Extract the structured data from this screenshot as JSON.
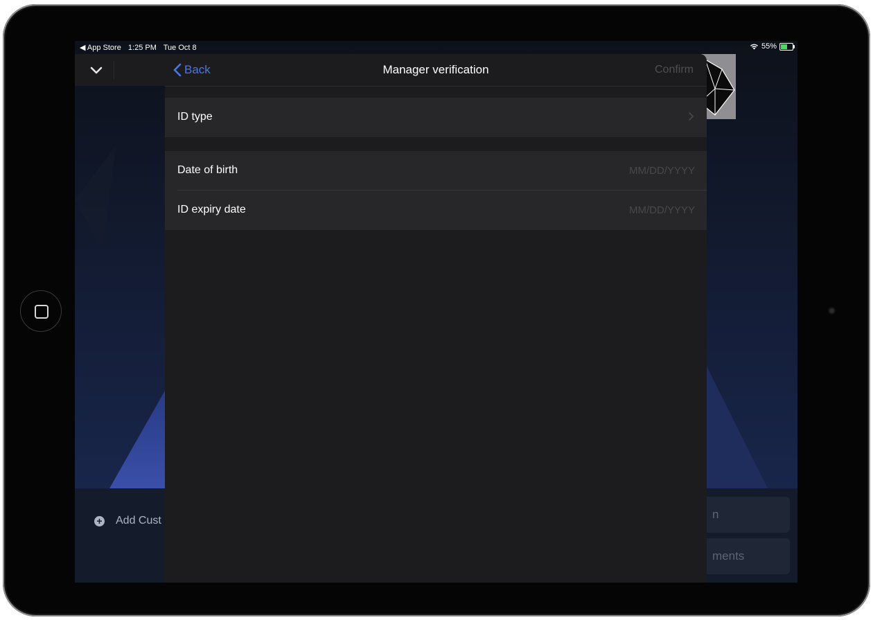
{
  "status_bar": {
    "back_app": "◀ App Store",
    "time": "1:25 PM",
    "date": "Tue Oct 8",
    "battery": "55%"
  },
  "background_app": {
    "add_customer_label": "Add Cust",
    "right_button_1_label": "n",
    "right_button_2_label": "ments"
  },
  "modal": {
    "back_label": "Back",
    "title": "Manager verification",
    "confirm_label": "Confirm",
    "id_type_label": "ID type",
    "date_of_birth": {
      "label": "Date of birth",
      "placeholder": "MM/DD/YYYY"
    },
    "id_expiry": {
      "label": "ID expiry date",
      "placeholder": "MM/DD/YYYY"
    }
  },
  "colors": {
    "accent": "#4a78e0",
    "modal_bg": "#1c1c1e",
    "cell_bg": "#27272a",
    "battery_green": "#4cd964"
  }
}
